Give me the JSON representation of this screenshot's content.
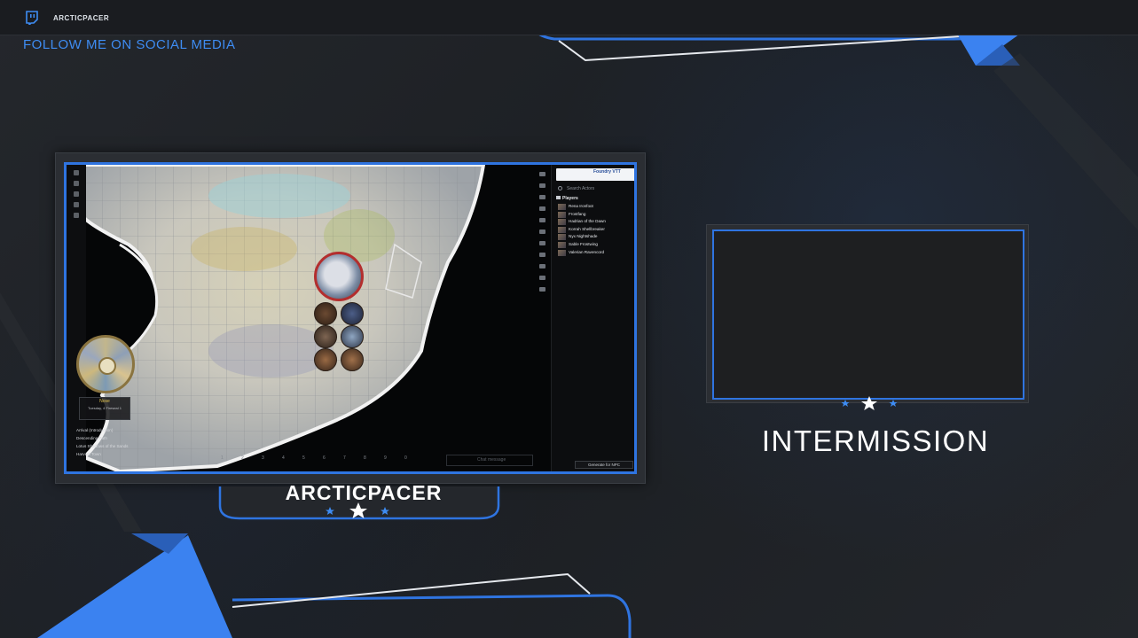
{
  "header": {
    "platform_icon": "twitch-icon",
    "channel_name": "ARCTICPACER",
    "social_text": "FOLLOW ME ON SOCIAL MEDIA"
  },
  "game": {
    "note": {
      "title": "Nose",
      "subtitle": "Tuesday, 4 Fireseal 1"
    },
    "scenes": [
      "Arrival (Introduction)",
      "Descending Path",
      "Lotus Shadows of the Sands",
      "Harvest Town"
    ],
    "hotbar": [
      "1",
      "2",
      "3",
      "4",
      "5",
      "6",
      "7",
      "8",
      "9",
      "0"
    ],
    "chat_placeholder": "Chat message",
    "sidebar": {
      "logo_text": "Foundry VTT",
      "search_placeholder": "Search Actors",
      "folder": "Players",
      "actors": [
        "Rena Ironfoot",
        "Frostfang",
        "Hadrian of the Dawn",
        "Korrah Shellbreaker",
        "Nyx Nightshade",
        "Sable Frostwing",
        "Valerian Ravencord"
      ],
      "create_button": "Generate for NPC"
    }
  },
  "overlay": {
    "name_plate": "ARCTICPACER",
    "intermission": "INTERMISSION"
  },
  "colors": {
    "accent": "#2f74e0",
    "social": "#3e8cf2",
    "background": "#1f2226"
  }
}
